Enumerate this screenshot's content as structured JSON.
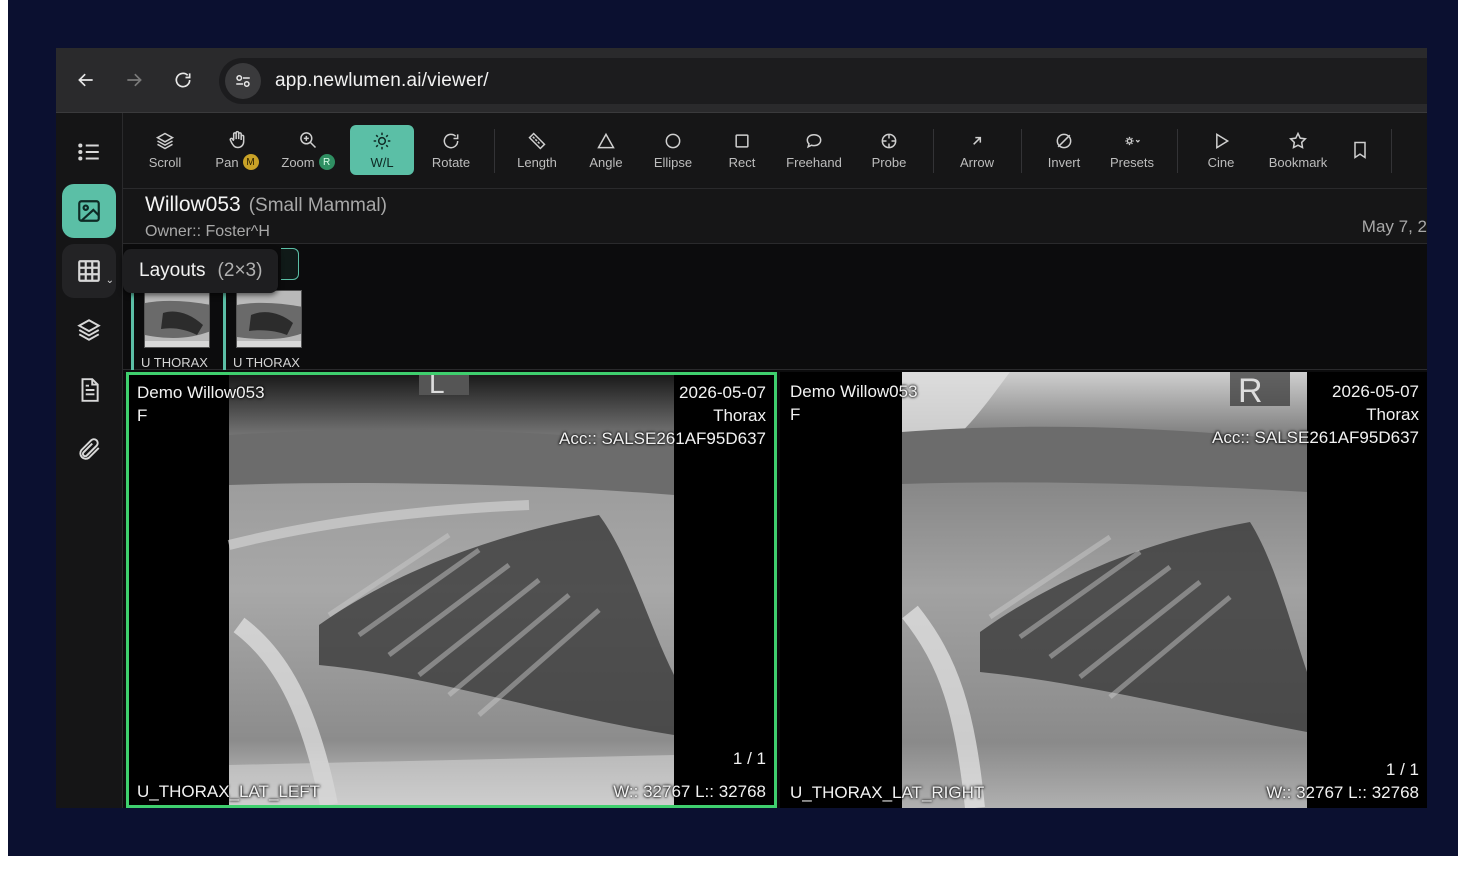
{
  "browser": {
    "url": "app.newlumen.ai/viewer/"
  },
  "toolbar": {
    "tools": [
      {
        "label": "Scroll",
        "icon": "layers-scroll-icon"
      },
      {
        "label": "Pan",
        "icon": "hand-icon",
        "shortcut": "M"
      },
      {
        "label": "Zoom",
        "icon": "zoom-icon",
        "shortcut": "R"
      },
      {
        "label": "W/L",
        "icon": "brightness-icon",
        "active": true
      },
      {
        "label": "Rotate",
        "icon": "rotate-icon"
      },
      {
        "label": "Length",
        "icon": "ruler-icon"
      },
      {
        "label": "Angle",
        "icon": "triangle-icon"
      },
      {
        "label": "Ellipse",
        "icon": "circle-icon"
      },
      {
        "label": "Rect",
        "icon": "square-icon"
      },
      {
        "label": "Freehand",
        "icon": "speech-bubble-icon"
      },
      {
        "label": "Probe",
        "icon": "crosshair-icon"
      },
      {
        "label": "Arrow",
        "icon": "arrow-up-right-icon"
      },
      {
        "label": "Invert",
        "icon": "invert-icon"
      },
      {
        "label": "Presets",
        "icon": "presets-icon"
      },
      {
        "label": "Cine",
        "icon": "play-icon"
      },
      {
        "label": "Bookmark",
        "icon": "star-icon"
      }
    ]
  },
  "patient": {
    "name": "Willow053",
    "species": "(Small Mammal)",
    "owner": "Owner:: Foster^H",
    "date": "May 7, 2"
  },
  "tooltip": {
    "title": "Layouts",
    "detail": "(2×3)"
  },
  "thumbnails": [
    {
      "label": "U THORAX"
    },
    {
      "label": "U THORAX"
    }
  ],
  "viewports": [
    {
      "patient": "Demo Willow053",
      "sex": "F",
      "date": "2026-05-07",
      "body_part": "Thorax",
      "accession": "Acc:: SALSE261AF95D637",
      "frame": "1 / 1",
      "series": "U_THORAX_LAT_LEFT",
      "window_level": "W:: 32767 L:: 32768",
      "marker": "L"
    },
    {
      "patient": "Demo Willow053",
      "sex": "F",
      "date": "2026-05-07",
      "body_part": "Thorax",
      "accession": "Acc:: SALSE261AF95D637",
      "frame": "1 / 1",
      "series": "U_THORAX_LAT_RIGHT",
      "window_level": "W:: 32767 L:: 32768",
      "marker": "R"
    }
  ],
  "colors": {
    "accent": "#5bbfa6",
    "active_viewport_border": "#3fcf6e",
    "background": "#0b1030"
  }
}
